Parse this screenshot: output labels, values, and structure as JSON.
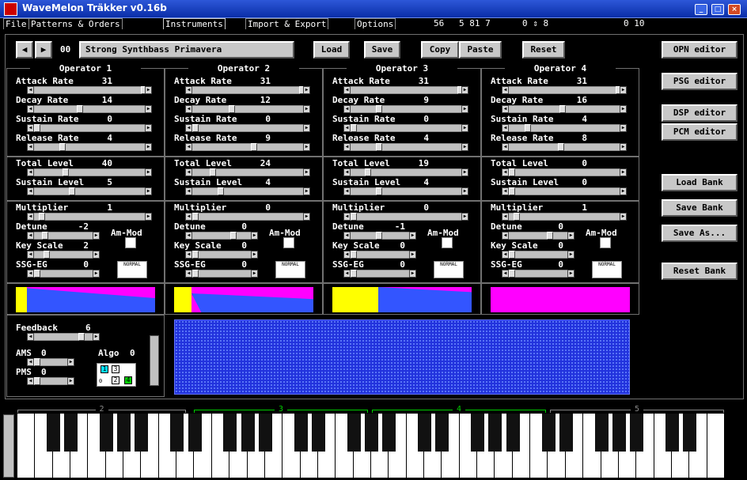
{
  "window": {
    "title": "WaveMelon Träkker v0.16b",
    "min": "_",
    "max": "□",
    "close": "×"
  },
  "menu": {
    "file": "File",
    "patterns": "Patterns & Orders",
    "instruments": "Instruments",
    "import": "Import & Export",
    "options": "Options"
  },
  "status": {
    "a": "56",
    "b": "5 81 7",
    "c": "0 ⇕ 8",
    "d": "0 10"
  },
  "toolbar": {
    "prev": "◀",
    "next": "▶",
    "index": "00",
    "name": "Strong Synthbass Primavera",
    "load": "Load",
    "save": "Save",
    "copy": "Copy",
    "paste": "Paste",
    "reset": "Reset"
  },
  "side": {
    "opn": "OPN editor",
    "psg": "PSG editor",
    "dsp": "DSP editor",
    "pcm": "PCM editor",
    "loadbank": "Load Bank",
    "savebank": "Save Bank",
    "saveas": "Save As...",
    "resetbank": "Reset Bank"
  },
  "labels": {
    "ar": "Attack Rate",
    "dr": "Decay Rate",
    "sr": "Sustain Rate",
    "rr": "Release Rate",
    "tl": "Total Level",
    "sl": "Sustain Level",
    "mul": "Multiplier",
    "dt": "Detune",
    "ks": "Key Scale",
    "ssg": "SSG-EG",
    "am": "Am-Mod",
    "normal": "NORMAL"
  },
  "operators": [
    {
      "name": "Operator 1",
      "ar": "31",
      "dr": "14",
      "sr": "0",
      "rr": "4",
      "tl": "40",
      "sl": "5",
      "mul": "1",
      "dt": "-2",
      "ks": "2",
      "ssg": "0"
    },
    {
      "name": "Operator 2",
      "ar": "31",
      "dr": "12",
      "sr": "0",
      "rr": "9",
      "tl": "24",
      "sl": "4",
      "mul": "0",
      "dt": "0",
      "ks": "0",
      "ssg": "0"
    },
    {
      "name": "Operator 3",
      "ar": "31",
      "dr": "9",
      "sr": "0",
      "rr": "4",
      "tl": "19",
      "sl": "4",
      "mul": "0",
      "dt": "-1",
      "ks": "0",
      "ssg": "0"
    },
    {
      "name": "Operator 4",
      "ar": "31",
      "dr": "16",
      "sr": "4",
      "rr": "8",
      "tl": "0",
      "sl": "0",
      "mul": "1",
      "dt": "0",
      "ks": "0",
      "ssg": "0"
    }
  ],
  "global": {
    "feedback_label": "Feedback",
    "feedback": "6",
    "ams_label": "AMS",
    "ams": "0",
    "pms_label": "PMS",
    "pms": "0",
    "algo_label": "Algo",
    "algo": "0"
  },
  "algo_diagram": {
    "n1": "1",
    "n2": "2",
    "n3": "3",
    "n4": "4",
    "out": "0"
  },
  "piano": {
    "octaves": [
      "2",
      "3",
      "4",
      "5"
    ]
  },
  "colors": {
    "yellow": "#ffff00",
    "magenta": "#ff00ff",
    "blue": "#3355ff",
    "green": "#00cc00",
    "cyan": "#00e0ff"
  }
}
